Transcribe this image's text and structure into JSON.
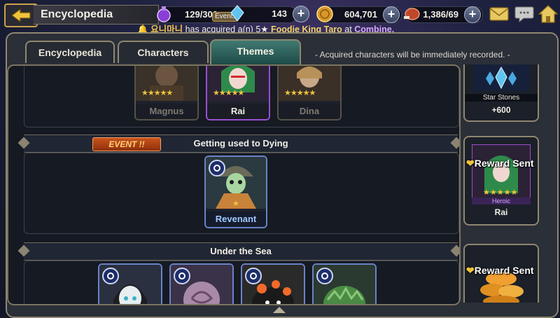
{
  "header": {
    "title": "Encyclopedia",
    "event_tag": "Event!",
    "resources": [
      {
        "name": "stamina",
        "value": "129/300"
      },
      {
        "name": "crystals",
        "value": "143"
      },
      {
        "name": "gold",
        "value": "604,701"
      },
      {
        "name": "meat",
        "value": "1,386/69"
      }
    ]
  },
  "ticker": {
    "username": "요니마니",
    "prefix": "has acquired a(n) 5★",
    "item": "Foodie King Taro",
    "middle": "at",
    "location": "Combine."
  },
  "tabs": [
    {
      "label": "Encyclopedia",
      "active": false
    },
    {
      "label": "Characters",
      "active": false
    },
    {
      "label": "Themes",
      "active": true
    }
  ],
  "tab_note": "- Acquired characters will be immediately recorded. -",
  "themes": [
    {
      "title": "",
      "characters": [
        {
          "name": "Magnus",
          "rarity": 5
        },
        {
          "name": "Rai",
          "rarity": 5
        },
        {
          "name": "Dina",
          "rarity": 5
        }
      ]
    },
    {
      "title": "Getting used to Dying",
      "event_label": "EVENT !!",
      "characters": [
        {
          "name": "Revenant",
          "rarity": 1
        }
      ]
    },
    {
      "title": "Under the Sea",
      "characters": [
        {
          "name": ""
        },
        {
          "name": ""
        },
        {
          "name": ""
        },
        {
          "name": ""
        }
      ]
    }
  ],
  "rewards": [
    {
      "label": "Star Stones",
      "amount": "+600",
      "status": ""
    },
    {
      "label": "Heroic",
      "name": "Rai",
      "status": "Reward Sent"
    },
    {
      "label": "",
      "status": "Reward Sent"
    }
  ],
  "colors": {
    "accent_gold": "#c9a24a",
    "active_tab": "#3f7a71",
    "event_orange": "#c9541c",
    "name_purple": "#d8a7ff"
  }
}
